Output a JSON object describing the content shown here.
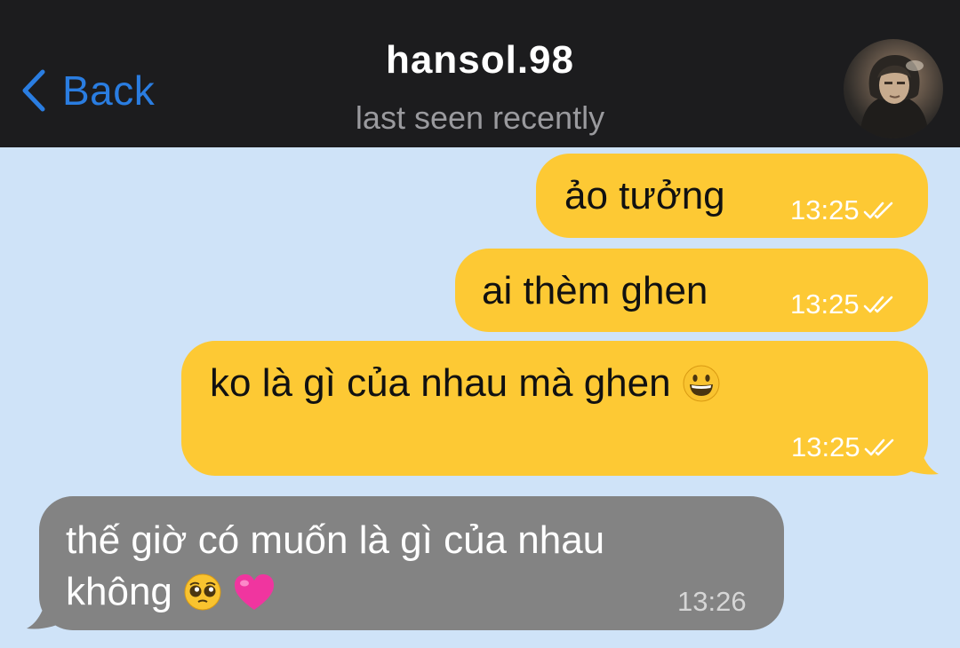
{
  "header": {
    "back_label": "Back",
    "title": "hansol.98",
    "subtitle": "last seen recently"
  },
  "messages": [
    {
      "direction": "outgoing",
      "text": "ảo tưởng",
      "time": "13:25",
      "status": "read"
    },
    {
      "direction": "outgoing",
      "text": "ai thèm ghen",
      "time": "13:25",
      "status": "read"
    },
    {
      "direction": "outgoing",
      "text": "ko là gì của nhau mà ghen",
      "emoji": [
        "grinning-face"
      ],
      "time": "13:25",
      "status": "read"
    },
    {
      "direction": "incoming",
      "text_line1": "thế giờ có muốn là gì của nhau",
      "text_line2": "không",
      "emoji": [
        "pleading-face",
        "pink-heart"
      ],
      "time": "13:26"
    }
  ],
  "colors": {
    "header_bg": "#1c1c1e",
    "chat_bg": "#cfe3f8",
    "outgoing_bubble": "#fdc934",
    "incoming_bubble": "#838383",
    "accent": "#2a7de1"
  },
  "icons": [
    "chevron-left-icon",
    "double-check-icon",
    "grinning-face-emoji",
    "pleading-face-emoji",
    "pink-heart-emoji"
  ]
}
